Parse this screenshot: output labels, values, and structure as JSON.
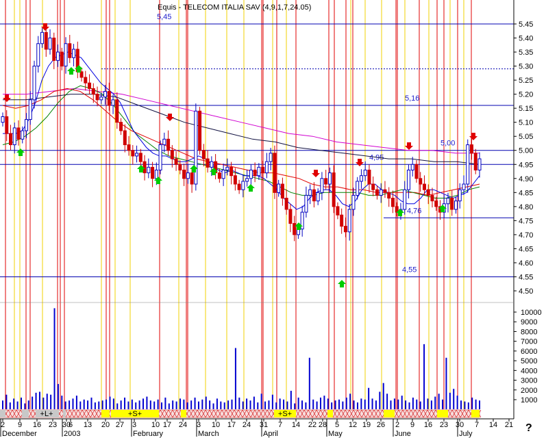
{
  "title": "Equis - TELECOM ITALIA SAV (4,9,1,7,24.05)",
  "help_glyph": "?",
  "chart_data": {
    "type": "candlestick",
    "price_axis": {
      "ticks": [
        "5.45",
        "5.40",
        "5.35",
        "5.30",
        "5.25",
        "5.20",
        "5.15",
        "5.10",
        "5.05",
        "5.00",
        "4.95",
        "4.90",
        "4.85",
        "4.80",
        "4.75",
        "4.70",
        "4.65",
        "4.60",
        "4.55",
        "4.50"
      ],
      "range": [
        4.48,
        5.48
      ]
    },
    "volume_axis": {
      "ticks": [
        "10000",
        "9000",
        "8000",
        "7000",
        "6000",
        "5000",
        "4000",
        "3000",
        "2000",
        "1000"
      ],
      "range": [
        0,
        11000
      ]
    },
    "date_axis": {
      "ticks": [
        "2",
        "9",
        "16",
        "23",
        "30",
        "6",
        "13",
        "20",
        "27",
        "3",
        "10",
        "17",
        "24",
        "3",
        "10",
        "17",
        "24",
        "31",
        "7",
        "14",
        "22",
        "28",
        "5",
        "12",
        "19",
        "26",
        "2",
        "9",
        "16",
        "23",
        "30",
        "7",
        "14",
        "21"
      ],
      "months": [
        "December",
        "2003",
        "February",
        "March",
        "April",
        "May",
        "June",
        "July"
      ]
    },
    "horizontal_levels": [
      {
        "value": 5.45,
        "label": "5,45"
      },
      {
        "value": 5.16,
        "label": "5,16"
      },
      {
        "value": 5.0,
        "label": "5,00"
      },
      {
        "value": 4.95,
        "label": "4,95"
      },
      {
        "value": 4.76,
        "label": "4,76"
      },
      {
        "value": 4.55,
        "label": "4,55"
      }
    ],
    "dotted_level": 5.29,
    "bands": [
      "+L+",
      "+S+",
      "+S+"
    ],
    "close": [
      5.12,
      5.06,
      5.02,
      5.08,
      5.04,
      5.07,
      5.11,
      5.18,
      5.3,
      5.38,
      5.42,
      5.36,
      5.4,
      5.32,
      5.35,
      5.3,
      5.38,
      5.33,
      5.36,
      5.28,
      5.26,
      5.24,
      5.22,
      5.2,
      5.18,
      5.19,
      5.21,
      5.16,
      5.18,
      5.1,
      5.07,
      5.02,
      5.0,
      4.98,
      4.99,
      4.96,
      4.92,
      4.94,
      4.9,
      4.93,
      5.02,
      5.04,
      5.0,
      4.97,
      4.95,
      4.93,
      4.9,
      4.92,
      4.88,
      5.14,
      5.0,
      4.97,
      4.94,
      4.96,
      4.92,
      4.9,
      4.93,
      4.94,
      4.91,
      4.88,
      4.86,
      4.89,
      4.9,
      4.93,
      4.91,
      4.94,
      4.92,
      4.96,
      4.99,
      4.85,
      4.88,
      4.83,
      4.79,
      4.74,
      4.7,
      4.72,
      4.78,
      4.84,
      4.86,
      4.82,
      4.85,
      4.9,
      4.88,
      4.92,
      4.8,
      4.77,
      4.73,
      4.71,
      4.79,
      4.84,
      4.89,
      4.91,
      4.93,
      4.88,
      4.86,
      4.84,
      4.86,
      4.85,
      4.83,
      4.8,
      4.78,
      4.79,
      4.86,
      4.93,
      4.95,
      4.9,
      4.88,
      4.86,
      4.84,
      4.82,
      4.8,
      4.78,
      4.81,
      4.83,
      4.79,
      4.82,
      4.86,
      4.88,
      5.02,
      4.99,
      4.93,
      4.97
    ],
    "ma_fast": [
      5.06,
      5.06,
      5.06,
      5.07,
      5.11,
      5.17,
      5.25,
      5.3,
      5.33,
      5.34,
      5.35,
      5.34,
      5.33,
      5.3,
      5.27,
      5.24,
      5.22,
      5.2,
      5.17,
      5.12,
      5.07,
      5.04,
      5.01,
      4.99,
      4.98,
      4.98,
      4.97,
      4.96,
      4.96,
      4.97,
      4.98,
      4.97,
      4.95,
      4.93,
      4.92,
      4.93,
      4.92,
      4.91,
      4.91,
      4.91,
      4.9,
      4.88,
      4.86,
      4.83,
      4.81,
      4.79,
      4.8,
      4.83,
      4.85,
      4.86,
      4.86,
      4.84,
      4.81,
      4.8,
      4.82,
      4.86,
      4.88,
      4.88,
      4.86,
      4.85,
      4.84,
      4.82,
      4.81,
      4.81,
      4.83,
      4.86,
      4.86,
      4.85,
      4.84,
      4.83,
      4.84,
      4.85,
      4.88,
      4.91
    ],
    "ma_mid": [
      5.02,
      5.03,
      5.05,
      5.08,
      5.12,
      5.17,
      5.21,
      5.23,
      5.22,
      5.2,
      5.16,
      5.11,
      5.06,
      5.03,
      5.0,
      4.98,
      4.97,
      4.96,
      4.95,
      4.94,
      4.93,
      4.92,
      4.91,
      4.9,
      4.89,
      4.87,
      4.85,
      4.84,
      4.84,
      4.85,
      4.85,
      4.85,
      4.85,
      4.84,
      4.84,
      4.85,
      4.86,
      4.85,
      4.84,
      4.83,
      4.83,
      4.84,
      4.86,
      4.87
    ],
    "ma_slow": [
      5.16,
      5.15,
      5.16,
      5.18,
      5.21,
      5.22,
      5.21,
      5.18,
      5.14,
      5.1,
      5.07,
      5.05,
      5.03,
      5.01,
      4.99,
      4.97,
      4.96,
      4.95,
      4.94,
      4.93,
      4.92,
      4.92,
      4.91,
      4.9,
      4.88,
      4.87,
      4.87,
      4.86,
      4.86,
      4.85,
      4.85,
      4.85,
      4.85,
      4.84,
      4.85,
      4.86,
      4.87,
      4.88
    ],
    "ma_long_dark": [
      5.18,
      5.18,
      5.19,
      5.2,
      5.2,
      5.19,
      5.16,
      5.13,
      5.1,
      5.08,
      5.06,
      5.04,
      5.03,
      5.01,
      5.0,
      4.99,
      4.98,
      4.97,
      4.97,
      4.96,
      4.96,
      4.95
    ],
    "ma_long_magenta": [
      5.2,
      5.2,
      5.21,
      5.22,
      5.21,
      5.2,
      5.18,
      5.16,
      5.14,
      5.12,
      5.1,
      5.08,
      5.06,
      5.05,
      5.03,
      5.02,
      5.01,
      5.0,
      5.0,
      4.99,
      4.99
    ],
    "volume": [
      900,
      1500,
      700,
      1100,
      800,
      1200,
      600,
      900,
      1300,
      1700,
      1800,
      1200,
      1600,
      1500,
      10400,
      2600,
      1400,
      800,
      900,
      1100,
      1400,
      800,
      1000,
      900,
      1200,
      700,
      800,
      900,
      1000,
      1300,
      1100,
      600,
      900,
      1200,
      800,
      1000,
      700,
      900,
      1100,
      1300,
      900,
      800,
      1000,
      700,
      1200,
      600,
      900,
      800,
      1100,
      1000,
      700,
      900,
      1200,
      800,
      1000,
      1300,
      900,
      600,
      1100,
      800,
      700,
      900,
      1000,
      6300,
      1200,
      800,
      1100,
      900,
      1300,
      700,
      1600,
      800,
      900,
      1500,
      700,
      1100,
      1000,
      800,
      1900,
      600,
      1200,
      900,
      700,
      5300,
      1000,
      800,
      1200,
      1400,
      1100,
      700,
      900,
      1000,
      800,
      1200,
      1600,
      900,
      700,
      1100,
      1000,
      2200,
      1100,
      900,
      1800,
      2700,
      1600,
      900,
      1100,
      1000,
      1400,
      900,
      700,
      1200,
      1000,
      800,
      6700,
      1100,
      900,
      1300,
      1600,
      1000,
      5300,
      1700,
      2100,
      1400,
      900,
      800,
      700,
      1200,
      1000,
      900
    ]
  }
}
